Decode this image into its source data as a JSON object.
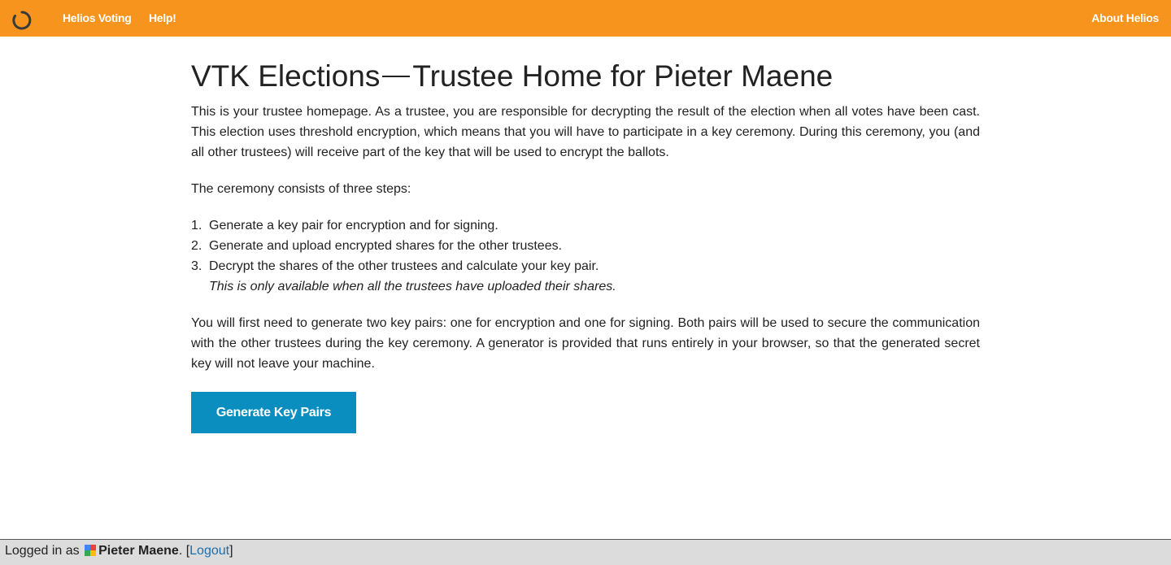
{
  "nav": {
    "logo_icon": "helios-spinner-icon",
    "helios_voting": "Helios Voting",
    "help": "Help!",
    "about": "About Helios"
  },
  "colors": {
    "topbar": "#f7941d",
    "button": "#0a8dbf",
    "link": "#1a6fb0",
    "footer": "#dcdcdc"
  },
  "main": {
    "title_prefix": "VTK Elections",
    "title_suffix": "Trustee Home for Pieter Maene",
    "intro": "This is your trustee homepage. As a trustee, you are responsible for decrypting the result of the election when all votes have been cast. This election uses threshold encryption, which means that you will have to participate in a key ceremony. During this ceremony, you (and all other trustees) will receive part of the key that will be used to encrypt the ballots.",
    "steps_intro": "The ceremony consists of three steps:",
    "steps": [
      {
        "num": "1.",
        "text": "Generate a key pair for encryption and for signing."
      },
      {
        "num": "2.",
        "text": "Generate and upload encrypted shares for the other trustees."
      },
      {
        "num": "3.",
        "text": "Decrypt the shares of the other trustees and calculate your key pair.",
        "note": "This is only available when all the trustees have uploaded their shares."
      }
    ],
    "keys_text": "You will first need to generate two key pairs: one for encryption and one for signing. Both pairs will be used to secure the communication with the other trustees during the key ceremony. A generator is provided that runs entirely in your browser, so that the generated secret key will not leave your machine.",
    "generate_button": "Generate Key Pairs"
  },
  "footer": {
    "logged_in_as": "Logged in as",
    "provider_icon": "google-icon",
    "username": "Pieter Maene",
    "after_name": ". [",
    "logout": "Logout",
    "close_bracket": "]"
  }
}
